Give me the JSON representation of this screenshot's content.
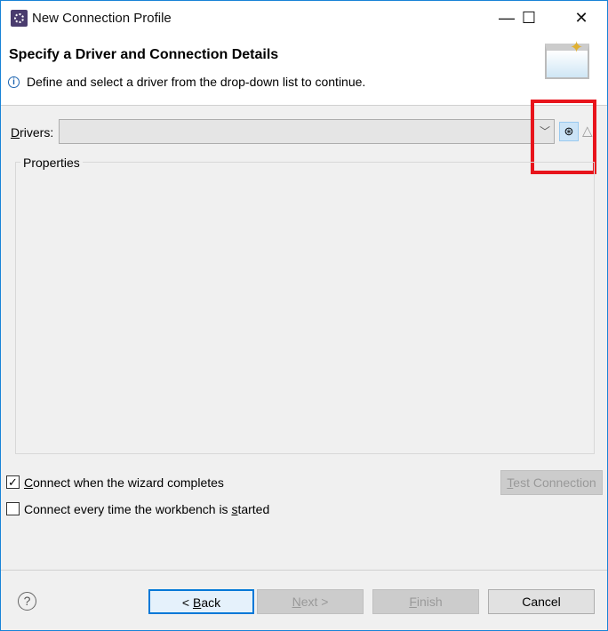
{
  "window": {
    "title": "New Connection Profile",
    "minimize": "—",
    "maximize": "☐",
    "close": "✕"
  },
  "header": {
    "title": "Specify a Driver and Connection Details",
    "info": "Define and select a driver from the drop-down list to continue."
  },
  "drivers": {
    "label_u": "D",
    "label_rest": "rivers:",
    "value": ""
  },
  "properties": {
    "label": "Properties"
  },
  "options": [
    {
      "pre": "",
      "u": "C",
      "post": "onnect when the wizard completes",
      "checked": true
    },
    {
      "pre": "Connect every time the workbench is ",
      "u": "s",
      "post": "tarted",
      "checked": false
    }
  ],
  "buttons": {
    "test_u": "T",
    "test_rest": "est Connection",
    "back_pre": "< ",
    "back_u": "B",
    "back_rest": "ack",
    "next_u": "N",
    "next_rest": "ext >",
    "finish_u": "F",
    "finish_rest": "inish",
    "cancel": "Cancel"
  },
  "colors": {
    "highlight": "#e8141c",
    "accent": "#1883d7"
  }
}
